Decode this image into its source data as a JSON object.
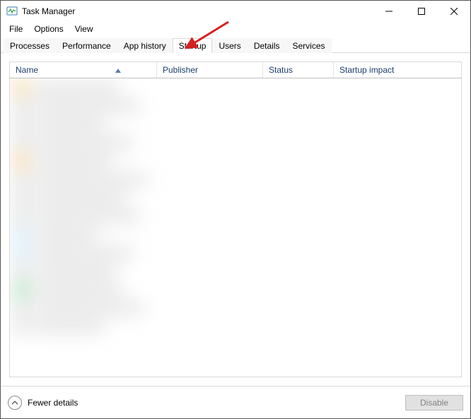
{
  "window": {
    "title": "Task Manager"
  },
  "menu": {
    "file": "File",
    "options": "Options",
    "view": "View"
  },
  "tabs": {
    "processes": "Processes",
    "performance": "Performance",
    "app_history": "App history",
    "startup": "Startup",
    "users": "Users",
    "details": "Details",
    "services": "Services"
  },
  "columns": {
    "name": "Name",
    "publisher": "Publisher",
    "status": "Status",
    "startup_impact": "Startup impact"
  },
  "footer": {
    "fewer_details": "Fewer details",
    "disable": "Disable"
  }
}
